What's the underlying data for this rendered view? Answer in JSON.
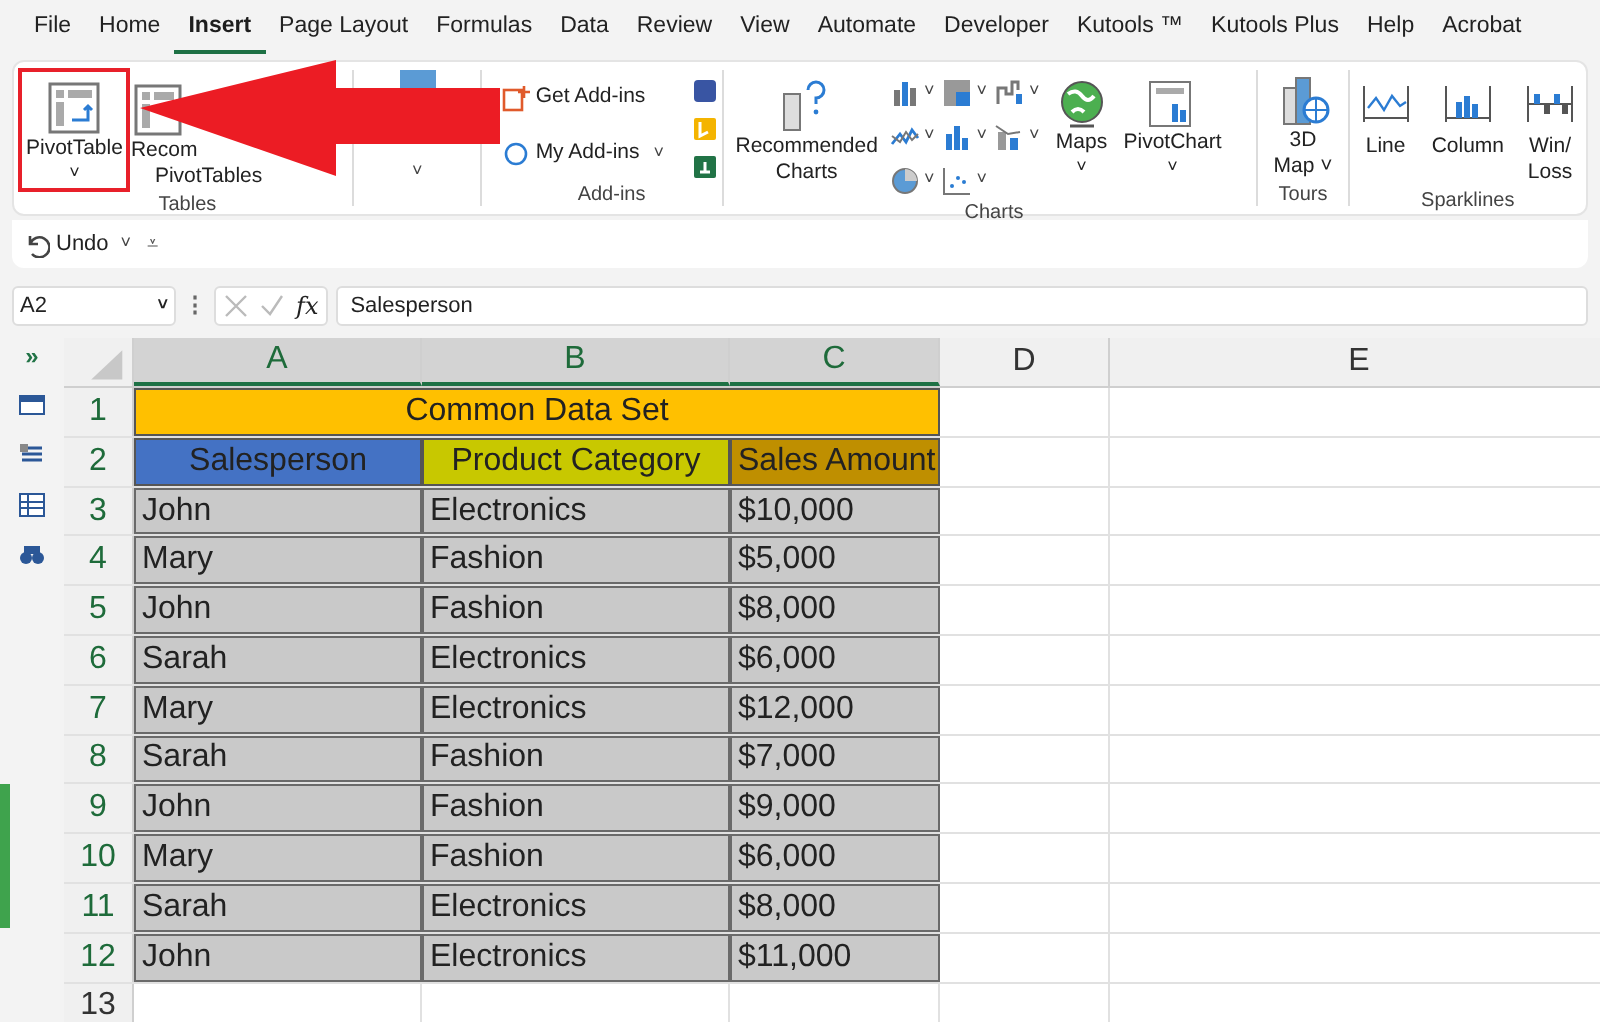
{
  "tabs": [
    {
      "label": "File",
      "selected": false
    },
    {
      "label": "Home",
      "selected": false
    },
    {
      "label": "Insert",
      "selected": true
    },
    {
      "label": "Page Layout",
      "selected": false
    },
    {
      "label": "Formulas",
      "selected": false
    },
    {
      "label": "Data",
      "selected": false
    },
    {
      "label": "Review",
      "selected": false
    },
    {
      "label": "View",
      "selected": false
    },
    {
      "label": "Automate",
      "selected": false
    },
    {
      "label": "Developer",
      "selected": false
    },
    {
      "label": "Kutools ™",
      "selected": false
    },
    {
      "label": "Kutools Plus",
      "selected": false
    },
    {
      "label": "Help",
      "selected": false
    },
    {
      "label": "Acrobat",
      "selected": false
    }
  ],
  "ribbon": {
    "tables": {
      "label": "Tables",
      "pivot": {
        "label": "PivotTable",
        "caret": "˅",
        "highlighted": true
      },
      "recommended": [
        "Recom",
        "PivotTables"
      ]
    },
    "illustrations": {
      "caret": "˅"
    },
    "addins": {
      "label": "Add-ins",
      "items": [
        "Get Add-ins",
        "My Add-ins"
      ],
      "caret": "˅"
    },
    "charts": {
      "label": "Charts",
      "recommended": [
        "Recommended",
        "Charts"
      ],
      "carets": [
        "˅",
        "˅",
        "˅",
        "˅",
        "˅",
        "˅",
        "˅",
        "˅"
      ],
      "maps": {
        "label": "Maps",
        "caret": "˅"
      },
      "pivotchart": {
        "label": "PivotChart",
        "caret": "˅"
      }
    },
    "tours": {
      "label": "Tours",
      "map": [
        "3D",
        "Map ˅"
      ]
    },
    "sparklines": {
      "label": "Sparklines",
      "items": [
        [
          "Line"
        ],
        [
          "Column"
        ],
        [
          "Win/",
          "Loss"
        ]
      ]
    }
  },
  "quick_access": {
    "undo": "Undo",
    "caret": "˅",
    "more": "⩡"
  },
  "formula_bar": {
    "name_box": "A2",
    "caret": "˅",
    "dots": "⋮",
    "fx": "fx",
    "value": "Salesperson"
  },
  "side_panel": {
    "expand": "»"
  },
  "sheet": {
    "columns": [
      {
        "label": "A",
        "selected": true
      },
      {
        "label": "B",
        "selected": true
      },
      {
        "label": "C",
        "selected": true
      },
      {
        "label": "D",
        "selected": false
      },
      {
        "label": "E",
        "selected": false
      }
    ],
    "title": {
      "row": "1",
      "text": "Common Data Set",
      "color": "#ffc000"
    },
    "header": {
      "row": "2",
      "cells": [
        {
          "text": "Salesperson",
          "color": "#4472c4"
        },
        {
          "text": "Product Category",
          "color": "#c8c800"
        },
        {
          "text": "Sales Amount",
          "color": "#bf8f00"
        }
      ]
    },
    "rows": [
      {
        "row": "3",
        "cells": [
          "John",
          "Electronics",
          "$10,000"
        ]
      },
      {
        "row": "4",
        "cells": [
          "Mary",
          "Fashion",
          "$5,000"
        ]
      },
      {
        "row": "5",
        "cells": [
          "John",
          "Fashion",
          "$8,000"
        ]
      },
      {
        "row": "6",
        "cells": [
          "Sarah",
          "Electronics",
          "$6,000"
        ]
      },
      {
        "row": "7",
        "cells": [
          "Mary",
          "Electronics",
          "$12,000"
        ]
      },
      {
        "row": "8",
        "cells": [
          "Sarah",
          "Fashion",
          "$7,000"
        ]
      },
      {
        "row": "9",
        "cells": [
          "John",
          "Fashion",
          "$9,000"
        ]
      },
      {
        "row": "10",
        "cells": [
          "Mary",
          "Fashion",
          "$6,000"
        ]
      },
      {
        "row": "11",
        "cells": [
          "Sarah",
          "Electronics",
          "$8,000"
        ]
      },
      {
        "row": "12",
        "cells": [
          "John",
          "Electronics",
          "$11,000"
        ]
      }
    ],
    "empty_rows": [
      "13"
    ]
  }
}
